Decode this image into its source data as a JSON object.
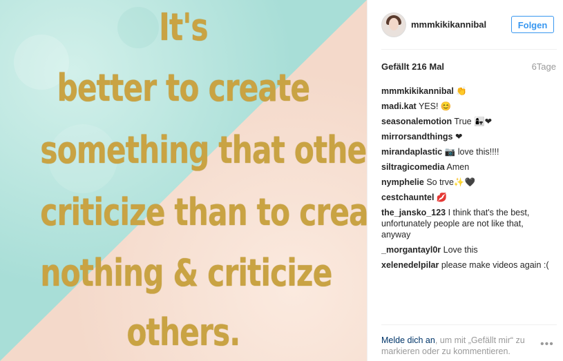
{
  "post": {
    "quote_lines": [
      "It's",
      "better to create",
      "something that others",
      "criticize than to create",
      "nothing & criticize",
      "others."
    ],
    "colors": {
      "mint": "#bfe8e2",
      "peach": "#f8e1d4",
      "gold": "#c9a343"
    }
  },
  "header": {
    "username": "mmmkikikannibal",
    "follow_label": "Folgen"
  },
  "stats": {
    "likes": "Gefällt 216 Mal",
    "time": "6Tage"
  },
  "comments": [
    {
      "user": "mmmkikikannibal",
      "text": "👏"
    },
    {
      "user": "madi.kat",
      "text": "YES! 😊"
    },
    {
      "user": "seasonalemotion",
      "text": "True 👩‍👧❤"
    },
    {
      "user": "mirrorsandthings",
      "text": "❤"
    },
    {
      "user": "mirandaplastic",
      "text": "📷 love this!!!!"
    },
    {
      "user": "siltragicomedia",
      "text": "Amen"
    },
    {
      "user": "nymphelie",
      "text": "So trve✨🖤"
    },
    {
      "user": "cestchauntel",
      "text": "💋"
    },
    {
      "user": "the_jansko_123",
      "text": "I think that's the best, unfortunately people are not like that, anyway"
    },
    {
      "user": "_morgantayl0r",
      "text": "Love this"
    },
    {
      "user": "xelenedelpilar",
      "text": "please make videos again :("
    }
  ],
  "footer": {
    "login_link": "Melde dich an",
    "rest": ", um mit „Gefällt mir“ zu markieren oder zu kommentieren.",
    "more_icon": "•••"
  }
}
